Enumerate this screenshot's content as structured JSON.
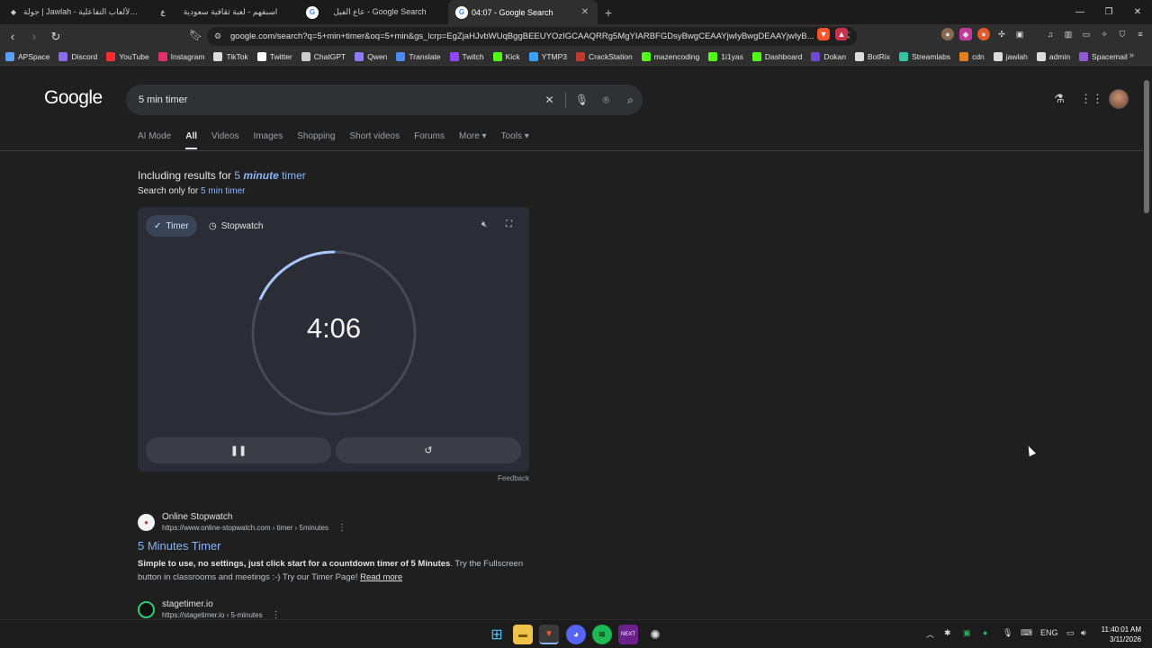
{
  "browser": {
    "tabs": [
      {
        "label": "جولة | Jawlah - منصة الألعاب التفاعلية",
        "icon": "jawlah-icon",
        "active": false
      },
      {
        "label": "اسبقهم - لعبة ثقافية سعودية",
        "icon": "asbeqhom-icon",
        "active": false
      },
      {
        "label": "عاع الفيل - Google Search",
        "icon": "google-icon",
        "active": false
      },
      {
        "label": "04:07 - Google Search",
        "icon": "google-icon",
        "active": true
      }
    ],
    "new_tab": "+",
    "url": "google.com/search?q=5+min+timer&oq=5+min&gs_lcrp=EgZjaHJvbWUqBggBEEUYOzIGCAAQRRg5MgYIARBFGDsyBwgCEAAYjwIyBwgDEAAYjwIyB...",
    "bookmarks": [
      {
        "label": "APSpace",
        "color": "#5aa0ff"
      },
      {
        "label": "Discord",
        "color": "#8c6cf0"
      },
      {
        "label": "YouTube",
        "color": "#ff2d2d"
      },
      {
        "label": "Instagram",
        "color": "#e1306c"
      },
      {
        "label": "TikTok",
        "color": "#dddddd"
      },
      {
        "label": "Twitter",
        "color": "#ffffff"
      },
      {
        "label": "ChatGPT",
        "color": "#cccccc"
      },
      {
        "label": "Qwen",
        "color": "#8b7cf6"
      },
      {
        "label": "Translate",
        "color": "#4c8bf5"
      },
      {
        "label": "Twitch",
        "color": "#9146ff"
      },
      {
        "label": "Kick",
        "color": "#53fc18"
      },
      {
        "label": "YTMP3",
        "color": "#3aa0ff"
      },
      {
        "label": "CrackStation",
        "color": "#c0392b"
      },
      {
        "label": "mazencoding",
        "color": "#53fc18"
      },
      {
        "label": "1i1yas",
        "color": "#53fc18"
      },
      {
        "label": "Dashboard",
        "color": "#53fc18"
      },
      {
        "label": "Dokan",
        "color": "#6c4bd1"
      },
      {
        "label": "BotRix",
        "color": "#dddddd"
      },
      {
        "label": "Streamlabs",
        "color": "#31c3a2"
      },
      {
        "label": "cdn",
        "color": "#e67e22"
      },
      {
        "label": "jawlah",
        "color": "#dddddd"
      },
      {
        "label": "admin",
        "color": "#dddddd"
      },
      {
        "label": "Spacemail",
        "color": "#8e5bd6"
      }
    ],
    "bookmarks_more": "»"
  },
  "google": {
    "logo": "Google",
    "query": "5 min timer",
    "tabs": [
      "AI Mode",
      "All",
      "Videos",
      "Images",
      "Shopping",
      "Short videos",
      "Forums",
      "More ▾",
      "Tools ▾"
    ],
    "active_tab": "All",
    "including_prefix": "Including results for ",
    "including_link_a": "5 ",
    "including_link_em": "minute",
    "including_link_b": " timer",
    "only_prefix": "Search only for ",
    "only_link": "5 min timer"
  },
  "timer": {
    "mode_timer": "Timer",
    "mode_stopwatch": "Stopwatch",
    "display": "4:06",
    "remaining_fraction": 0.82,
    "accent": "#a8c7fa",
    "feedback": "Feedback"
  },
  "results": [
    {
      "site": "Online Stopwatch",
      "url": "https://www.online-stopwatch.com › timer › 5minutes",
      "title": "5 Minutes Timer",
      "snippet_bold": "Simple to use, no settings, just click start for a countdown timer of 5 Minutes",
      "snippet_rest": ". Try the Fullscreen button in classrooms and meetings :-) Try our Timer Page!",
      "read_more": "Read more"
    },
    {
      "site": "stagetimer.io",
      "url": "https://stagetimer.io › 5-minutes"
    }
  ],
  "taskbar": {
    "language": "ENG",
    "time": "11:40:01 AM",
    "date": "3/11/2026"
  }
}
